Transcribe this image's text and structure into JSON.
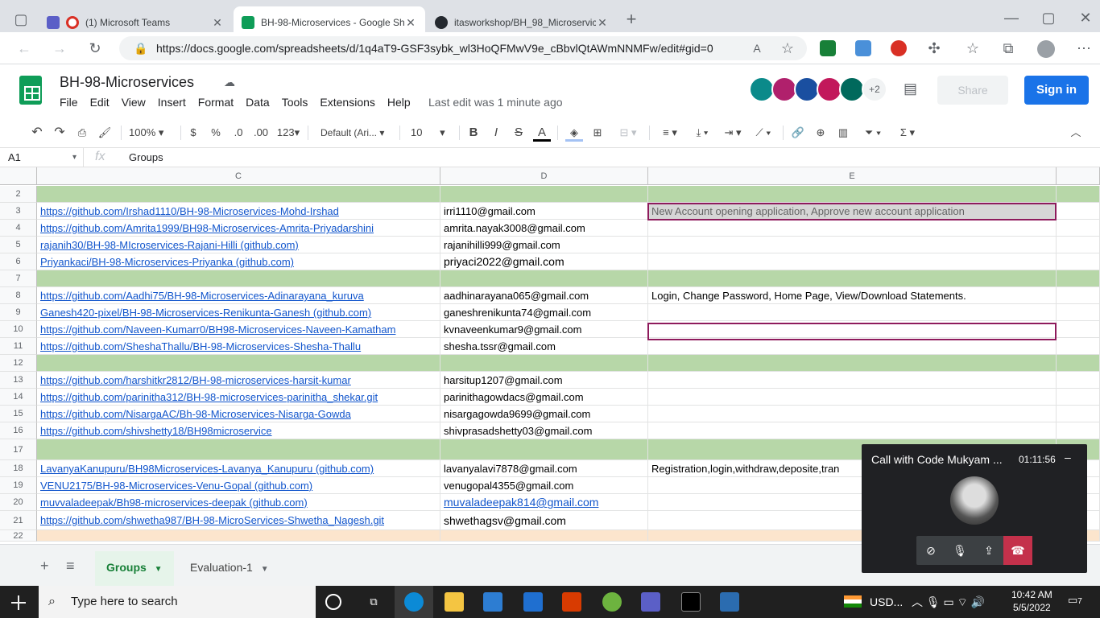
{
  "browser": {
    "tabs": [
      {
        "title": "(1) Microsoft Teams",
        "active": false
      },
      {
        "title": "BH-98-Microservices - Google Sh",
        "active": true
      },
      {
        "title": "itasworkshop/BH_98_Microservic",
        "active": false
      }
    ],
    "new_tab_label": "+",
    "url": "https://docs.google.com/spreadsheets/d/1q4aT9-GSF3sybk_wl3HoQFMwV9e_cBbvlQtAWmNNMFw/edit#gid=0"
  },
  "doc": {
    "title": "BH-98-Microservices",
    "menus": [
      "File",
      "Edit",
      "View",
      "Insert",
      "Format",
      "Data",
      "Tools",
      "Extensions",
      "Help"
    ],
    "last_edit": "Last edit was 1 minute ago",
    "avatar_more": "+2",
    "share_label": "Share",
    "signin_label": "Sign in"
  },
  "toolbar": {
    "zoom": "100%",
    "currency": "$",
    "percent": "%",
    "dec_decrease": ".0",
    "dec_increase": ".00",
    "format_more": "123",
    "font": "Default (Ari...",
    "font_size": "10",
    "bold": "B",
    "italic": "I",
    "strike": "S",
    "textcolor": "A"
  },
  "formula": {
    "namebox": "A1",
    "fx": "fx",
    "value": "Groups"
  },
  "columns": [
    "C",
    "D",
    "E"
  ],
  "rows": [
    {
      "num": "2",
      "c": "",
      "d": "",
      "e": "",
      "fill": "green"
    },
    {
      "num": "3",
      "c": "https://github.com/Irshad1110/BH-98-Microservices-Mohd-Irshad",
      "d": "irri1110@gmail.com",
      "e": "New Account opening application, Approve new account application",
      "fill": ""
    },
    {
      "num": "4",
      "c": "https://github.com/Amrita1999/BH98-Microservices-Amrita-Priyadarshini",
      "d": "amrita.nayak3008@gmail.com",
      "e": "",
      "fill": ""
    },
    {
      "num": "5",
      "c": "rajanih30/BH-98-MIcroservices-Rajani-Hilli (github.com)",
      "d": "rajanihilli999@gmail.com",
      "e": "",
      "fill": ""
    },
    {
      "num": "6",
      "c": "Priyankaci/BH-98-Microservices-Priyanka (github.com)",
      "d": "priyaci2022@gmail.com",
      "e": "",
      "fill": ""
    },
    {
      "num": "7",
      "c": "",
      "d": "",
      "e": "",
      "fill": "green"
    },
    {
      "num": "8",
      "c": "https://github.com/Aadhi75/BH-98-Microservices-Adinarayana_kuruva",
      "d": "aadhinarayana065@gmail.com",
      "e": " Login, Change Password, Home Page, View/Download Statements.",
      "fill": ""
    },
    {
      "num": "9",
      "c": "Ganesh420-pixel/BH-98-Microservices-Renikunta-Ganesh (github.com)",
      "d": "ganeshrenikunta74@gmail.com",
      "e": "",
      "fill": ""
    },
    {
      "num": "10",
      "c": "https://github.com/Naveen-Kumarr0/BH98-Microservices-Naveen-Kamatham",
      "d": "kvnaveenkumar9@gmail.com",
      "e": "",
      "fill": ""
    },
    {
      "num": "11",
      "c": "https://github.com/SheshaThallu/BH-98-Microservices-Shesha-Thallu",
      "d": "shesha.tssr@gmail.com",
      "e": "",
      "fill": ""
    },
    {
      "num": "12",
      "c": "",
      "d": "",
      "e": "",
      "fill": "green"
    },
    {
      "num": "13",
      "c": "https://github.com/harshitkr2812/BH-98-microservices-harsit-kumar",
      "d": "harsitup1207@gmail.com",
      "e": "",
      "fill": ""
    },
    {
      "num": "14",
      "c": "https://github.com/parinitha312/BH-98-microservices-parinitha_shekar.git",
      "d": "parinithagowdacs@gmail.com",
      "e": "",
      "fill": ""
    },
    {
      "num": "15",
      "c": "https://github.com/NisargaAC/Bh-98-Microservices-Nisarga-Gowda",
      "d": "nisargagowda9699@gmail.com",
      "e": "",
      "fill": ""
    },
    {
      "num": "16",
      "c": "https://github.com/shivshetty18/BH98microservice",
      "d": "shivprasadshetty03@gmail.com",
      "e": "",
      "fill": ""
    },
    {
      "num": "17",
      "c": "",
      "d": "",
      "e": "",
      "fill": "green"
    },
    {
      "num": "18",
      "c": "LavanyaKanupuru/BH98Microservices-Lavanya_Kanupuru (github.com)",
      "d": "lavanyalavi7878@gmail.com",
      "e": "Registration,login,withdraw,deposite,tran",
      "fill": ""
    },
    {
      "num": "19",
      "c": "VENU2175/BH-98-Microservices-Venu-Gopal (github.com)",
      "d": "venugopal4355@gmail.com",
      "e": "",
      "fill": ""
    },
    {
      "num": "20",
      "c": "muvvaladeepak/Bh98-microservices-deepak (github.com)",
      "d": "muvaladeepak814@gmail.com",
      "e": "",
      "fill": ""
    },
    {
      "num": "21",
      "c": "https://github.com/shwetha987/BH-98-MicroServices-Shwetha_Nagesh.git",
      "d": "shwethagsv@gmail.com",
      "e": "",
      "fill": ""
    },
    {
      "num": "22",
      "c": "",
      "d": "",
      "e": "",
      "fill": "peach"
    }
  ],
  "sheets": {
    "add": "+",
    "list": "≡",
    "tabs": [
      {
        "label": "Groups",
        "active": true
      },
      {
        "label": "Evaluation-1",
        "active": false
      }
    ]
  },
  "call": {
    "title": "Call with Code Mukyam ...",
    "time": "01:11:56",
    "min": "–"
  },
  "taskbar": {
    "search_placeholder": "Type here to search",
    "currency": "USD...",
    "time": "10:42 AM",
    "date": "5/5/2022",
    "notif": "7"
  },
  "colors": {
    "green_row": "#b7d7a8",
    "peach_row": "#fce5cd",
    "link": "#1155cc",
    "signin": "#1a73e8",
    "selected_border": "#8e1b5c"
  }
}
